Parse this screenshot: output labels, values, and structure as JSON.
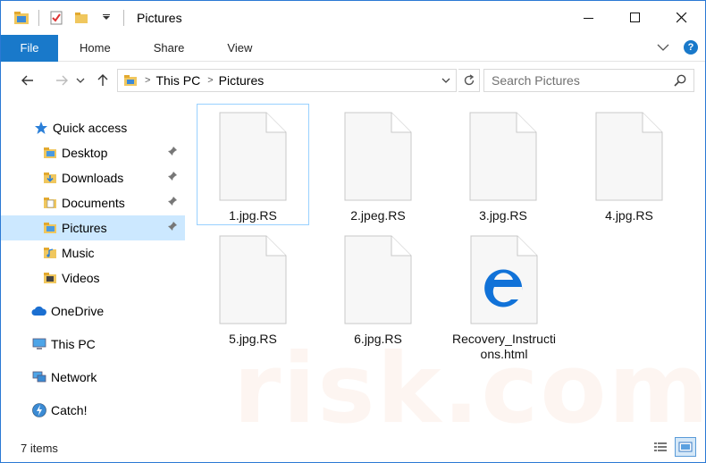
{
  "window": {
    "title": "Pictures"
  },
  "ribbon": {
    "tabs": [
      "File",
      "Home",
      "Share",
      "View"
    ]
  },
  "address": {
    "segments": [
      "This PC",
      "Pictures"
    ]
  },
  "search": {
    "placeholder": "Search Pictures"
  },
  "sidebar": {
    "items": [
      {
        "label": "Quick access",
        "icon": "star-icon",
        "level": 0
      },
      {
        "label": "Desktop",
        "icon": "folder-icon",
        "level": 1,
        "pinned": true
      },
      {
        "label": "Downloads",
        "icon": "folder-download-icon",
        "level": 1,
        "pinned": true
      },
      {
        "label": "Documents",
        "icon": "folder-documents-icon",
        "level": 1,
        "pinned": true
      },
      {
        "label": "Pictures",
        "icon": "folder-pictures-icon",
        "level": 1,
        "pinned": true,
        "selected": true
      },
      {
        "label": "Music",
        "icon": "folder-music-icon",
        "level": 1
      },
      {
        "label": "Videos",
        "icon": "folder-videos-icon",
        "level": 1
      },
      {
        "label": "OneDrive",
        "icon": "cloud-icon",
        "level": 0
      },
      {
        "label": "This PC",
        "icon": "computer-icon",
        "level": 0
      },
      {
        "label": "Network",
        "icon": "network-icon",
        "level": 0
      },
      {
        "label": "Catch!",
        "icon": "catch-icon",
        "level": 0
      }
    ]
  },
  "files": [
    {
      "name": "1.jpg.RS",
      "type": "blank"
    },
    {
      "name": "2.jpeg.RS",
      "type": "blank"
    },
    {
      "name": "3.jpg.RS",
      "type": "blank"
    },
    {
      "name": "4.jpg.RS",
      "type": "blank"
    },
    {
      "name": "5.jpg.RS",
      "type": "blank"
    },
    {
      "name": "6.jpg.RS",
      "type": "blank"
    },
    {
      "name": "Recovery_Instructions.html",
      "type": "edge-html"
    }
  ],
  "status": {
    "item_count": "7 items"
  },
  "colors": {
    "accent": "#1979ca",
    "selection": "#cce8ff",
    "folder": "#e8b53c"
  }
}
